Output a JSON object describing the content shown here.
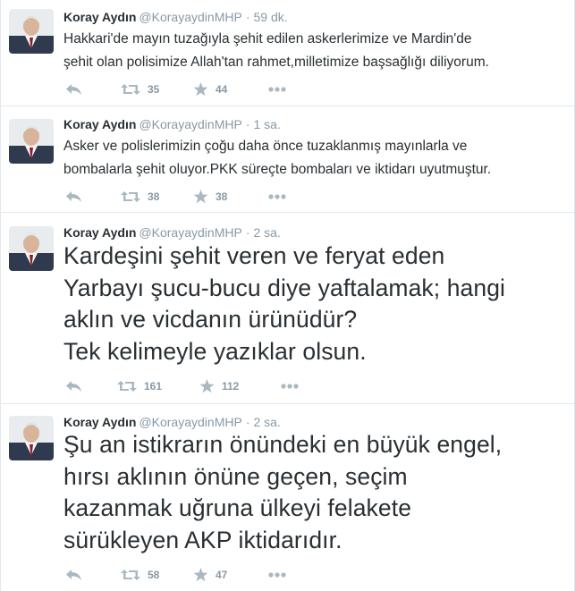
{
  "tweets": [
    {
      "fullname": "Koray Aydın",
      "username": "@KorayaydinMHP",
      "separator": "·",
      "time": "59 dk.",
      "lines": [
        "Hakkari'de mayın tuzağıyla şehit edilen askerlerimize ve Mardin'de",
        "şehit olan polisimize Allah'tan rahmet,milletimize başsağlığı diliyorum."
      ],
      "retweets": "35",
      "favorites": "44"
    },
    {
      "fullname": "Koray Aydın",
      "username": "@KorayaydinMHP",
      "separator": "·",
      "time": "1 sa.",
      "lines": [
        "Asker ve polislerimizin çoğu daha önce tuzaklanmış mayınlarla ve",
        "bombalarla şehit oluyor.PKK süreçte bombaları ve iktidarı uyutmuştur."
      ],
      "retweets": "38",
      "favorites": "38"
    },
    {
      "fullname": "Koray Aydın",
      "username": "@KorayaydinMHP",
      "separator": "·",
      "time": "2 sa.",
      "lines": [
        "Kardeşini şehit veren ve feryat eden",
        "Yarbayı şucu-bucu diye yaftalamak; hangi",
        "aklın ve vicdanın ürünüdür?",
        "Tek kelimeyle yazıklar olsun."
      ],
      "retweets": "161",
      "favorites": "112"
    },
    {
      "fullname": "Koray Aydın",
      "username": "@KorayaydinMHP",
      "separator": "·",
      "time": "2 sa.",
      "lines": [
        "Şu an istikrarın önündeki en büyük engel,",
        "hırsı aklının önüne geçen, seçim",
        "kazanmak uğruna ülkeyi felakete",
        "sürükleyen AKP iktidarıdır."
      ],
      "retweets": "58",
      "favorites": "47"
    }
  ],
  "icons": {
    "reply": "reply-icon",
    "retweet": "retweet-icon",
    "favorite": "star-icon",
    "more": "more-icon"
  },
  "colors": {
    "action_gray": "#aab8c2",
    "meta_gray": "#8899a6",
    "text": "#292f33",
    "divider": "#e1e8ed"
  }
}
